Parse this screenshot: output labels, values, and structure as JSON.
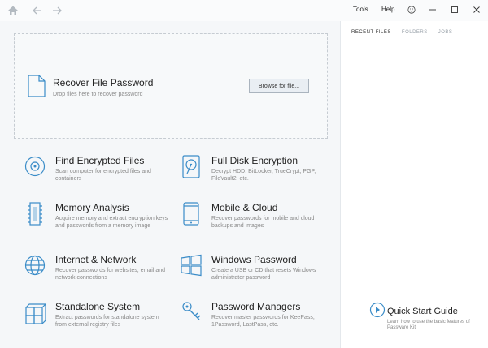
{
  "menu": {
    "tools": "Tools",
    "help": "Help"
  },
  "colors": {
    "accent": "#3a8cc8",
    "main_bg": "#f5f7f9"
  },
  "dropzone": {
    "title": "Recover File Password",
    "subtitle": "Drop files here to recover password",
    "browse_label": "Browse for file..."
  },
  "tiles": [
    {
      "title": "Find Encrypted Files",
      "desc": "Scan computer for encrypted files and containers",
      "icon": "disk-icon"
    },
    {
      "title": "Full Disk Encryption",
      "desc": "Decrypt HDD: BitLocker, TrueCrypt, PGP, FileVault2, etc.",
      "icon": "hdd-icon"
    },
    {
      "title": "Memory Analysis",
      "desc": "Acquire memory and extract encryption keys and passwords from a memory image",
      "icon": "memory-chip-icon"
    },
    {
      "title": "Mobile & Cloud",
      "desc": "Recover passwords for mobile and cloud backups and images",
      "icon": "mobile-icon"
    },
    {
      "title": "Internet & Network",
      "desc": "Recover passwords for websites, email and network connections",
      "icon": "globe-icon"
    },
    {
      "title": "Windows Password",
      "desc": "Create a USB or CD that resets Windows administrator password",
      "icon": "windows-icon"
    },
    {
      "title": "Standalone System",
      "desc": "Extract passwords for standalone system from external registry files",
      "icon": "cubes-icon"
    },
    {
      "title": "Password Managers",
      "desc": "Recover master passwords for KeePass, 1Password, LastPass, etc.",
      "icon": "keys-icon"
    }
  ],
  "side": {
    "tabs": [
      {
        "label": "RECENT FILES",
        "active": true
      },
      {
        "label": "FOLDERS",
        "active": false
      },
      {
        "label": "JOBS",
        "active": false
      }
    ],
    "quick_start": {
      "title": "Quick Start Guide",
      "subtitle": "Learn how to use the basic features of Passware Kit"
    }
  }
}
